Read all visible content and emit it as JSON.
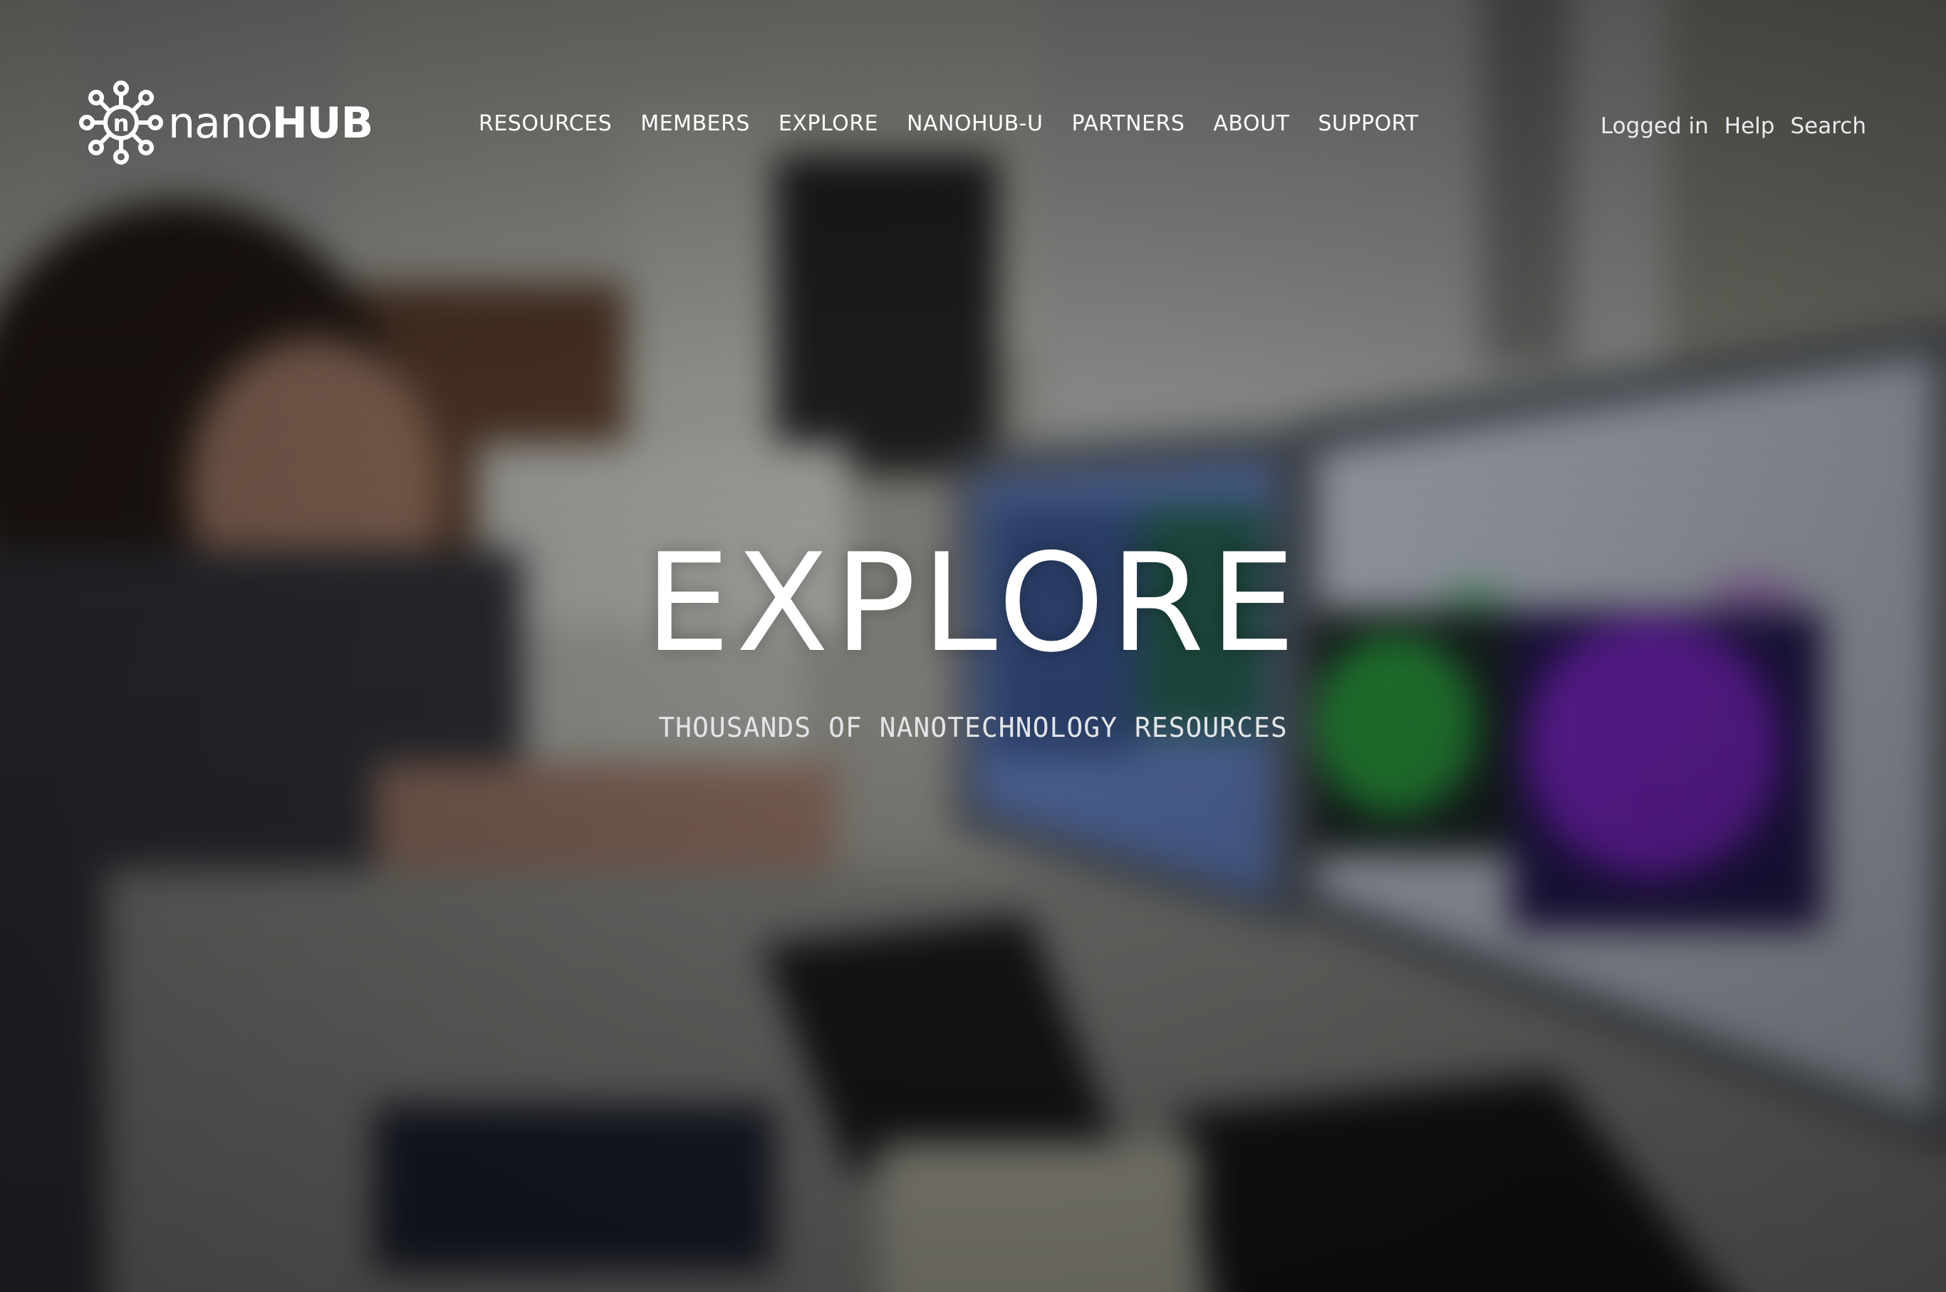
{
  "brand": {
    "name_light": "nano",
    "name_bold": "HUB",
    "logo_icon": "nanohub-logo-icon"
  },
  "nav": {
    "items": [
      {
        "label": "RESOURCES"
      },
      {
        "label": "MEMBERS"
      },
      {
        "label": "EXPLORE"
      },
      {
        "label": "NANOHUB-U"
      },
      {
        "label": "PARTNERS"
      },
      {
        "label": "ABOUT"
      },
      {
        "label": "SUPPORT"
      }
    ]
  },
  "user_nav": {
    "logged_in": "Logged in",
    "help": "Help",
    "search": "Search"
  },
  "hero": {
    "title": "EXPLORE",
    "subtitle": "THOUSANDS OF NANOTECHNOLOGY RESOURCES",
    "background": "hero-background-lab-photo"
  },
  "colors": {
    "text": "#ffffff",
    "overlay": "#000000",
    "screen_green": "#2fae47",
    "screen_magenta": "#8a2be2",
    "screen_blue": "#6f8fd8"
  }
}
